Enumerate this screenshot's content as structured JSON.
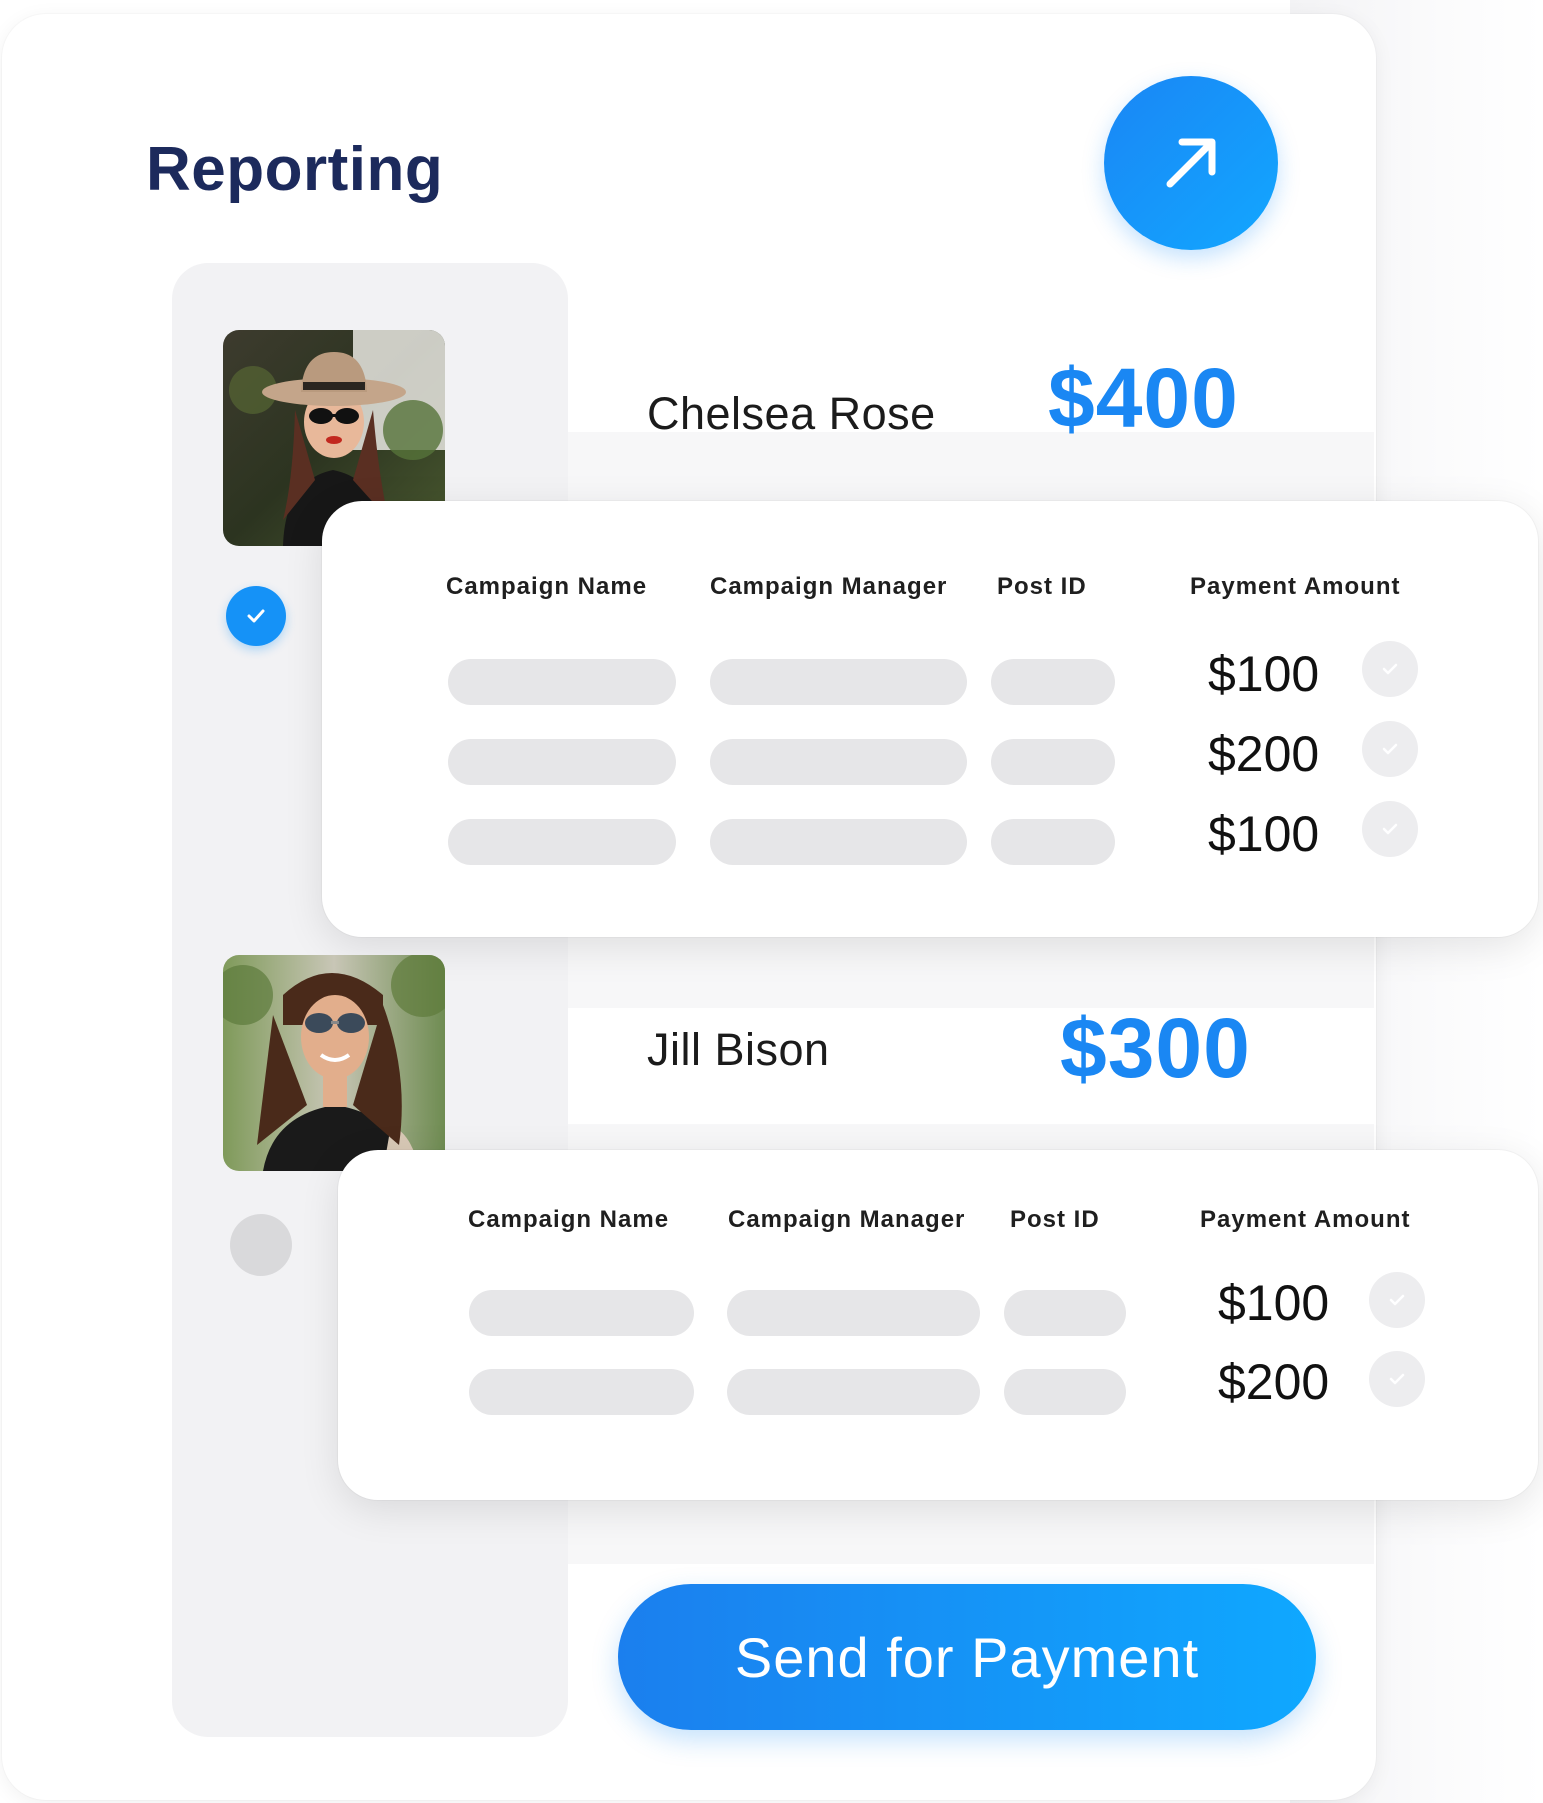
{
  "header": {
    "title": "Reporting"
  },
  "accent_color": "#1a87f3",
  "people": [
    {
      "name": "Chelsea Rose",
      "total": "$400",
      "selected": true,
      "table": {
        "headers": [
          "Campaign Name",
          "Campaign Manager",
          "Post ID",
          "Payment Amount"
        ],
        "amounts": [
          "$100",
          "$200",
          "$100"
        ]
      }
    },
    {
      "name": "Jill Bison",
      "total": "$300",
      "selected": false,
      "table": {
        "headers": [
          "Campaign Name",
          "Campaign Manager",
          "Post ID",
          "Payment Amount"
        ],
        "amounts": [
          "$100",
          "$200"
        ]
      }
    }
  ],
  "actions": {
    "send_label": "Send for Payment"
  },
  "icons": {
    "fab": "arrow-up-right-icon",
    "selected": "check-icon",
    "row_check": "check-icon"
  }
}
